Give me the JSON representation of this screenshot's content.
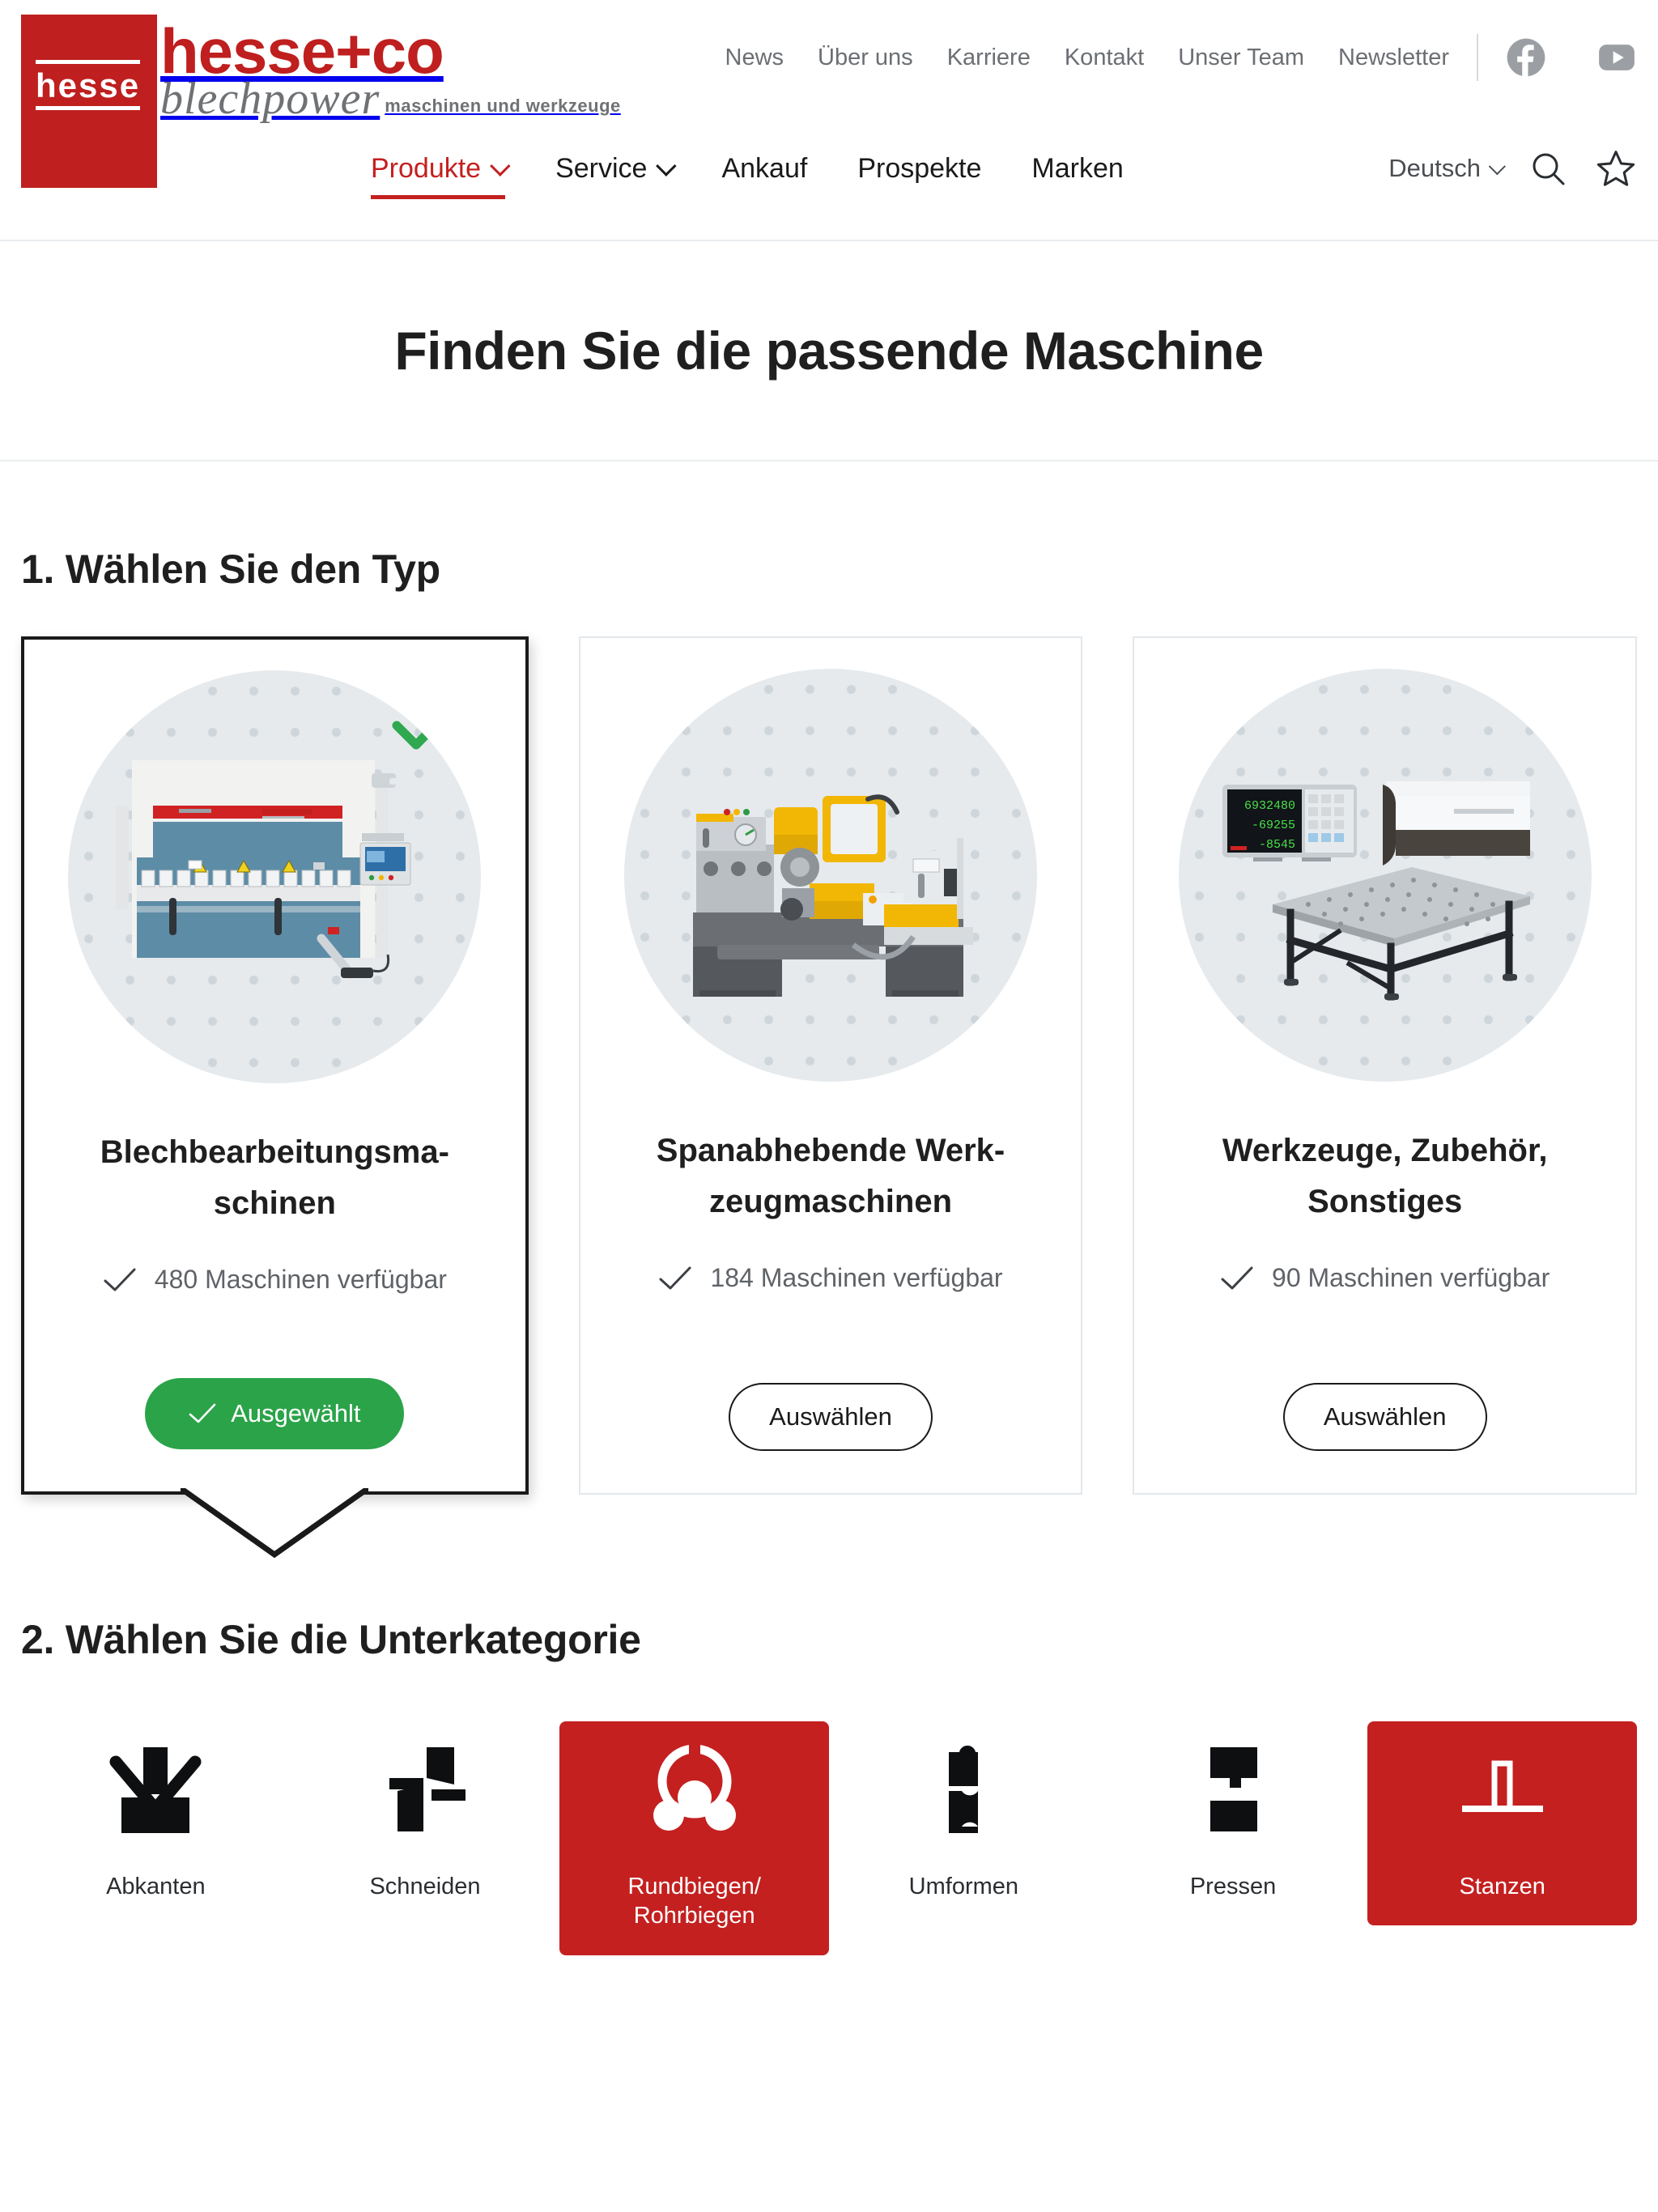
{
  "brand": {
    "badge_text": "hesse",
    "wordmark": "hesse+co",
    "sub_italic": "blechpower",
    "tagline": "maschinen und werkzeuge"
  },
  "top_nav": {
    "items": [
      {
        "label": "News"
      },
      {
        "label": "Über uns"
      },
      {
        "label": "Karriere"
      },
      {
        "label": "Kontakt"
      },
      {
        "label": "Unser Team"
      },
      {
        "label": "Newsletter"
      }
    ],
    "social": [
      {
        "name": "facebook-icon"
      },
      {
        "name": "youtube-icon"
      }
    ]
  },
  "main_nav": {
    "items": [
      {
        "label": "Produkte",
        "has_caret": true,
        "active": true
      },
      {
        "label": "Service",
        "has_caret": true,
        "active": false
      },
      {
        "label": "Ankauf",
        "has_caret": false,
        "active": false
      },
      {
        "label": "Prospekte",
        "has_caret": false,
        "active": false
      },
      {
        "label": "Marken",
        "has_caret": false,
        "active": false
      }
    ],
    "language": "Deutsch",
    "search_icon": "search-icon",
    "favorites_icon": "star-icon",
    "accent_color": "#c42020"
  },
  "page": {
    "title": "Finden Sie die passende Maschine"
  },
  "step1": {
    "heading": "1. Wählen Sie den Typ",
    "cards": [
      {
        "title": "Blechbearbeitungsma-\nschinen",
        "title_line1": "Blechbearbeitungsma-",
        "title_line2": "schinen",
        "availability": "480 Maschinen verfügbar",
        "count": 480,
        "button_label": "Ausgewählt",
        "selected": true,
        "image": "press-brake-machine-photo"
      },
      {
        "title_line1": "Spanabhebende Werk-",
        "title_line2": "zeugmaschinen",
        "availability": "184 Maschinen verfügbar",
        "count": 184,
        "button_label": "Auswählen",
        "selected": false,
        "image": "lathe-machine-photo"
      },
      {
        "title_line1": "Werkzeuge, Zubehör,",
        "title_line2": "Sonstiges",
        "availability": "90 Maschinen verfügbar",
        "count": 90,
        "button_label": "Auswählen",
        "selected": false,
        "image": "tools-accessories-photo",
        "dro_readout": [
          "6932480",
          "-69255",
          "-8545"
        ]
      }
    ],
    "selected_color": "#2ba349"
  },
  "step2": {
    "heading": "2. Wählen Sie die Unterkategorie",
    "items": [
      {
        "label": "Abkanten",
        "icon": "bending-icon",
        "active": false
      },
      {
        "label": "Schneiden",
        "icon": "shearing-icon",
        "active": false
      },
      {
        "label": "Rundbiegen/\nRohrbiegen",
        "label_line1": "Rundbiegen/",
        "label_line2": "Rohrbiegen",
        "icon": "roll-bending-icon",
        "active": true
      },
      {
        "label": "Umformen",
        "icon": "forming-icon",
        "active": false
      },
      {
        "label": "Pressen",
        "icon": "pressing-icon",
        "active": false
      },
      {
        "label": "Stanzen",
        "icon": "punching-icon",
        "active": true
      }
    ],
    "active_color": "#c42020"
  }
}
